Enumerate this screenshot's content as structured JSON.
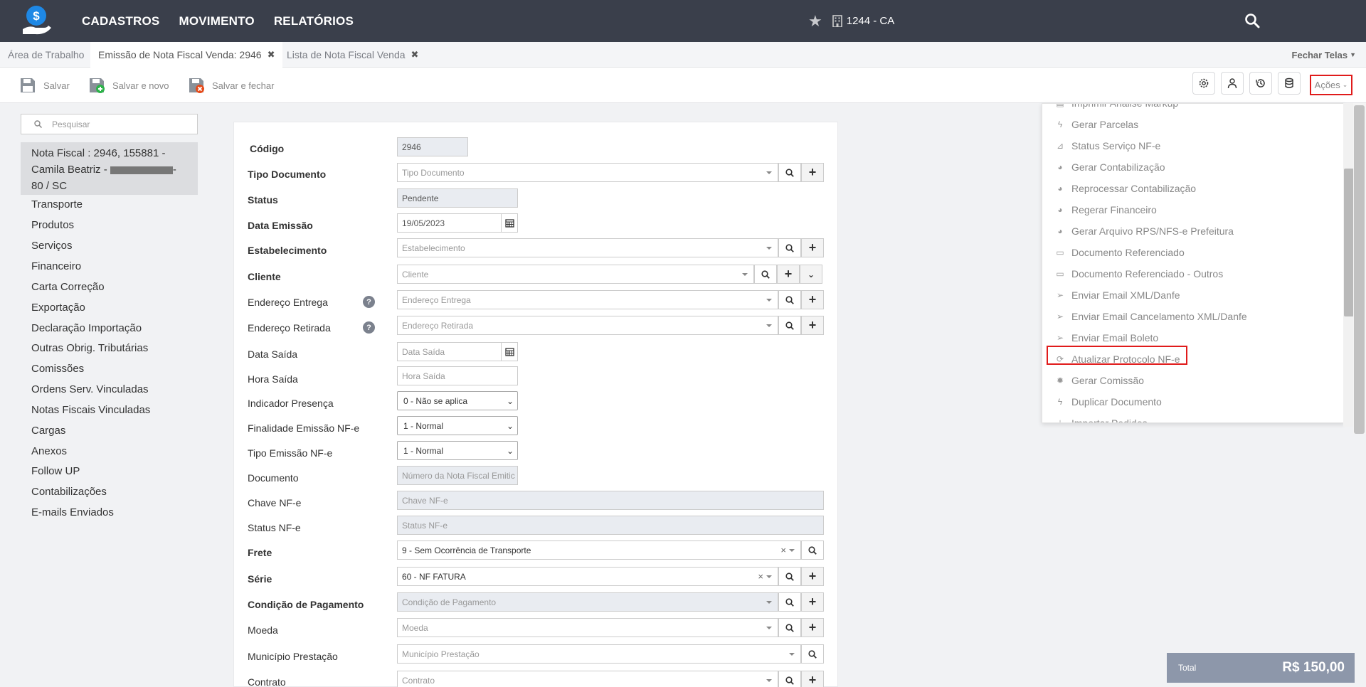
{
  "navbar": {
    "menu": [
      "CADASTROS",
      "MOVIMENTO",
      "RELATÓRIOS"
    ],
    "company": "1244 - CA"
  },
  "tabs": [
    {
      "label": "Área de Trabalho"
    },
    {
      "label": "Emissão de Nota Fiscal Venda: 2946"
    },
    {
      "label": "Lista de Nota Fiscal Venda"
    }
  ],
  "close_all": "Fechar Telas",
  "toolbar": {
    "save": "Salvar",
    "save_new": "Salvar e novo",
    "save_close": "Salvar e fechar",
    "acoes": "Ações"
  },
  "left": {
    "search_placeholder": "Pesquisar",
    "record_line1": "Nota Fiscal : 2946, 155881 -",
    "record_line2a": "Camila Beatriz -",
    "record_line2b": "-",
    "record_line3": "80 / SC",
    "items": [
      "Transporte",
      "Produtos",
      "Serviços",
      "Financeiro",
      "Carta Correção",
      "Exportação",
      "Declaração Importação",
      "Outras Obrig. Tributárias",
      "Comissões",
      "Ordens Serv. Vinculadas",
      "Notas Fiscais Vinculadas",
      "Cargas",
      "Anexos",
      "Follow UP",
      "Contabilizações",
      "E-mails Enviados"
    ]
  },
  "form": {
    "labels": {
      "codigo": "Código",
      "tipo_doc": "Tipo Documento",
      "status": "Status",
      "data_emissao": "Data Emissão",
      "estabelecimento": "Estabelecimento",
      "cliente": "Cliente",
      "end_entrega": "Endereço Entrega",
      "end_retirada": "Endereço Retirada",
      "data_saida": "Data Saída",
      "hora_saida": "Hora Saída",
      "ind_presenca": "Indicador Presença",
      "finalidade": "Finalidade Emissão NF-e",
      "tipo_emissao": "Tipo Emissão NF-e",
      "documento": "Documento",
      "chave": "Chave NF-e",
      "status_nfe": "Status NF-e",
      "frete": "Frete",
      "serie": "Série",
      "cond_pag": "Condição de Pagamento",
      "moeda": "Moeda",
      "municipio": "Município Prestação",
      "contrato": "Contrato"
    },
    "values": {
      "codigo": "2946",
      "status": "Pendente",
      "data_emissao": "19/05/2023",
      "ind_presenca": "0 - Não se aplica",
      "finalidade": "1 - Normal",
      "tipo_emissao": "1 - Normal",
      "frete": "9 - Sem Ocorrência de Transporte",
      "serie": "60 - NF FATURA"
    },
    "placeholders": {
      "tipo_doc": "Tipo Documento",
      "estabelecimento": "Estabelecimento",
      "cliente": "Cliente",
      "end_entrega": "Endereço Entrega",
      "end_retirada": "Endereço Retirada",
      "data_saida": "Data Saída",
      "hora_saida": "Hora Saída",
      "documento": "Número da Nota Fiscal Emitic",
      "chave": "Chave NF-e",
      "status_nfe": "Status NF-e",
      "cond_pag": "Condição de Pagamento",
      "moeda": "Moeda",
      "municipio": "Município Prestação",
      "contrato": "Contrato"
    }
  },
  "actions_menu": {
    "items": [
      {
        "label": "Imprimir Análise Markup",
        "icon": "print-icon"
      },
      {
        "label": "Gerar Parcelas",
        "icon": "bolt-icon"
      },
      {
        "label": "Status Serviço NF-e",
        "icon": "rss-icon"
      },
      {
        "label": "Gerar Contabilização",
        "icon": "aperture-icon"
      },
      {
        "label": "Reprocessar Contabilização",
        "icon": "aperture-icon"
      },
      {
        "label": "Regerar Financeiro",
        "icon": "aperture-icon"
      },
      {
        "label": "Gerar Arquivo RPS/NFS-e Prefeitura",
        "icon": "aperture-icon"
      },
      {
        "label": "Documento Referenciado",
        "icon": "file-icon"
      },
      {
        "label": "Documento Referenciado - Outros",
        "icon": "file-icon"
      },
      {
        "label": "Enviar Email XML/Danfe",
        "icon": "send-icon"
      },
      {
        "label": "Enviar Email Cancelamento XML/Danfe",
        "icon": "send-icon"
      },
      {
        "label": "Enviar Email Boleto",
        "icon": "send-icon"
      },
      {
        "label": "Atualizar Protocolo NF-e",
        "icon": "refresh-icon"
      },
      {
        "label": "Gerar Comissão",
        "icon": "gear-icon"
      },
      {
        "label": "Duplicar Documento",
        "icon": "bolt-icon"
      },
      {
        "label": "Importar Pedidos",
        "icon": "import-icon"
      }
    ]
  },
  "total": {
    "label": "Total",
    "value": "R$ 150,00"
  }
}
